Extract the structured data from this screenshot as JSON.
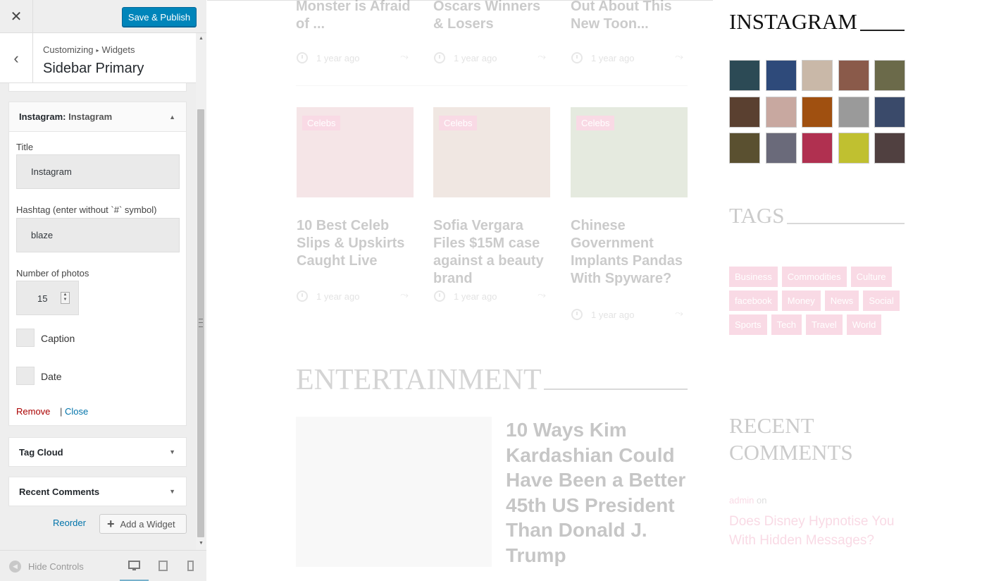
{
  "topbar": {
    "close_glyph": "✕",
    "save_label": "Save & Publish"
  },
  "header": {
    "back_glyph": "‹",
    "breadcrumb_root": "Customizing",
    "breadcrumb_arrow": "▸",
    "breadcrumb_leaf": "Widgets",
    "title": "Sidebar Primary"
  },
  "instagram_widget": {
    "head_type": "Instagram:",
    "head_name": "Instagram",
    "title_label": "Title",
    "title_value": "Instagram",
    "hashtag_label": "Hashtag (enter without `#` symbol)",
    "hashtag_value": "blaze",
    "photos_label": "Number of photos",
    "photos_value": "15",
    "caption_label": "Caption",
    "date_label": "Date",
    "remove_label": "Remove",
    "separator": "|",
    "close_label": "Close"
  },
  "widgets_collapsed": [
    {
      "label": "Tag Cloud"
    },
    {
      "label": "Recent Comments"
    }
  ],
  "actions": {
    "reorder_label": "Reorder",
    "add_widget_label": "Add a Widget"
  },
  "footer": {
    "hide_controls_label": "Hide Controls"
  },
  "icons": {
    "caret_up": "▲",
    "caret_down": "▼",
    "plus": "+",
    "desktop": "🖥",
    "tablet": "▭",
    "mobile": "▯",
    "share": "⤳",
    "hide": "◀"
  },
  "preview": {
    "top_posts": [
      {
        "title": "Monster is Afraid of ...",
        "meta": "1 year ago"
      },
      {
        "title": "Oscars Winners & Losers",
        "meta": "1 year ago"
      },
      {
        "title": "Out About This New Toon...",
        "meta": "1 year ago"
      }
    ],
    "celeb_posts": [
      {
        "badge": "Celebs",
        "title": "10 Best Celeb Slips & Upskirts Caught Live",
        "meta": "1 year ago",
        "img_color": "#d9a0a8"
      },
      {
        "badge": "Celebs",
        "title": "Sofia Vergara Files $15M case against a beauty brand",
        "meta": "1 year ago",
        "img_color": "#c9a998"
      },
      {
        "badge": "Celebs",
        "title": "Chinese Government Implants Pandas With Spyware?",
        "meta": "1 year ago",
        "img_color": "#a3b28c"
      }
    ],
    "section_heading": "ENTERTAINMENT",
    "feature_title": "10 Ways Kim Kardashian Could Have Been a Better 45th US President Than Donald J. Trump",
    "sidebar": {
      "instagram_heading": "INSTAGRAM",
      "instagram_photo_colors": [
        "#2c4a55",
        "#2e4a7a",
        "#c9b8a8",
        "#8a5a4a",
        "#6b6a4a",
        "#5a4030",
        "#c8a8a0",
        "#a05010",
        "#9a9a9a",
        "#3a4a6a",
        "#5a5030",
        "#6a6a7a",
        "#b03050",
        "#c0c030",
        "#504040"
      ],
      "tags_heading": "TAGS",
      "tags": [
        "Business",
        "Commodities",
        "Culture",
        "facebook",
        "Money",
        "News",
        "Social",
        "Sports",
        "Tech",
        "Travel",
        "World"
      ],
      "recent_comments_heading": "RECENT COMMENTS",
      "comment_author": "admin",
      "comment_on": "on",
      "comment_link": "Does Disney Hypnotise You With Hidden Messages?"
    }
  },
  "colors": {
    "accent": "#0085ba",
    "link": "#0073aa",
    "remove": "#aa0000",
    "tag_pink": "#e87aa0"
  }
}
